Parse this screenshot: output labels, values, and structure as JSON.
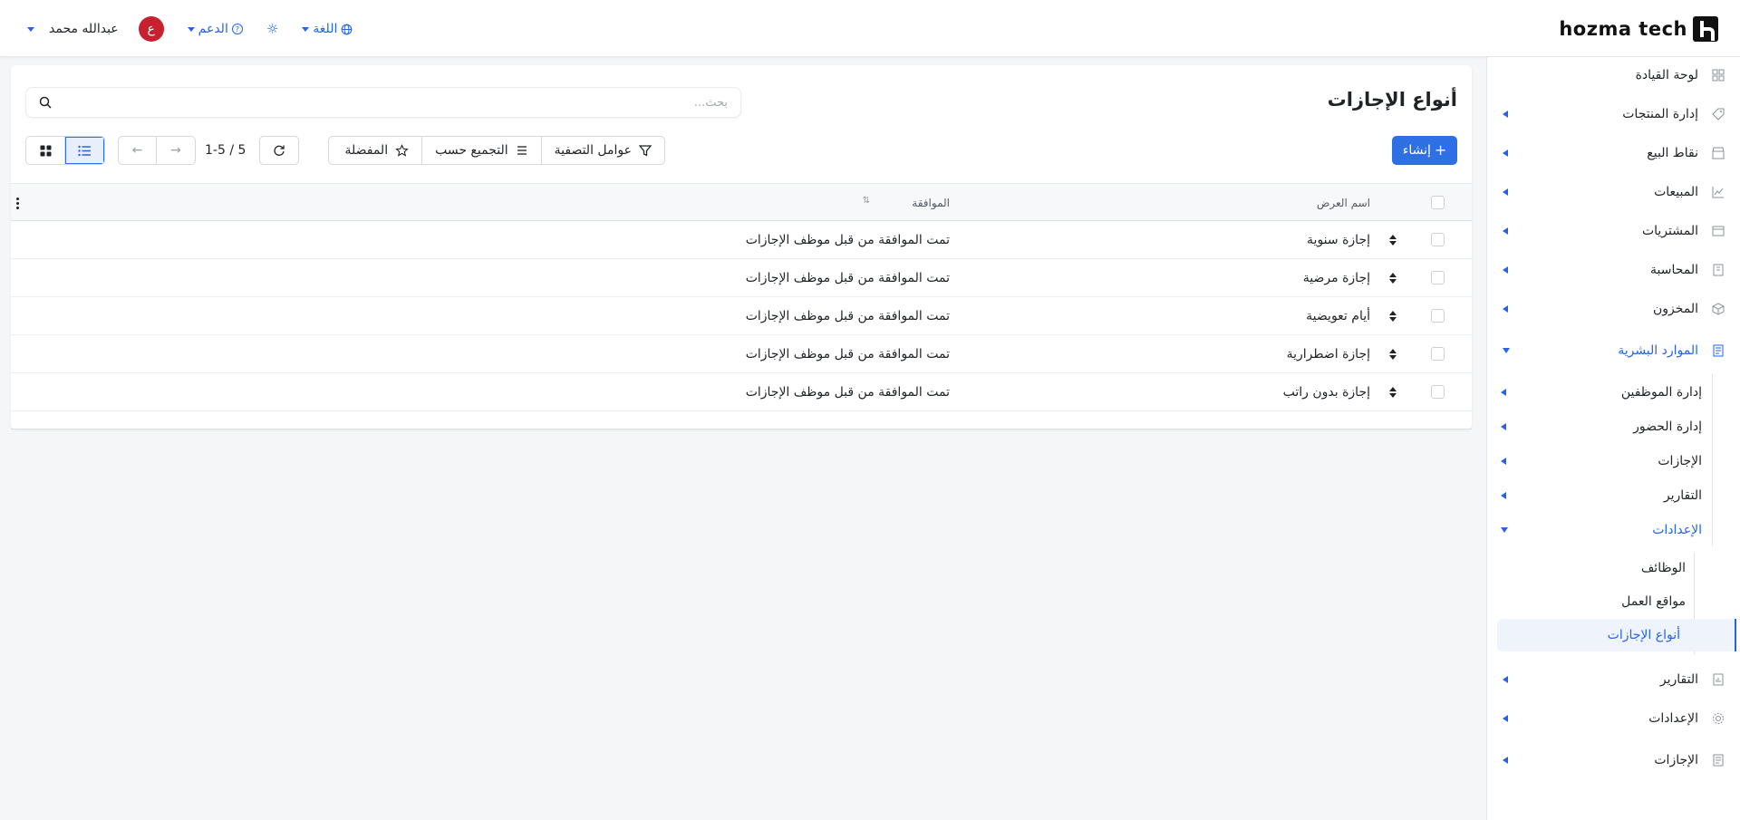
{
  "header": {
    "brand": "hozma tech",
    "user_name": "عبدالله محمد",
    "avatar_initial": "ع",
    "support_label": "الدعم",
    "language_label": "اللغة"
  },
  "sidebar": {
    "items": [
      {
        "label": "لوحة القيادة"
      },
      {
        "label": "إدارة المنتجات"
      },
      {
        "label": "نقاط البيع"
      },
      {
        "label": "المبيعات"
      },
      {
        "label": "المشتريات"
      },
      {
        "label": "المحاسبة"
      },
      {
        "label": "المخزون"
      },
      {
        "label": "الموارد البشرية"
      }
    ],
    "hr_sub": [
      {
        "label": "إدارة الموظفين"
      },
      {
        "label": "إدارة الحضور"
      },
      {
        "label": "الإجازات"
      },
      {
        "label": "التقارير"
      },
      {
        "label": "الإعدادات"
      }
    ],
    "settings_sub": [
      {
        "label": "الوظائف"
      },
      {
        "label": "مواقع العمل"
      },
      {
        "label": "أنواع الإجازات"
      }
    ],
    "bottom_items": [
      {
        "label": "التقارير"
      },
      {
        "label": "الإعدادات"
      },
      {
        "label": "الإجازات"
      }
    ],
    "accent_color": "#2563eb"
  },
  "main": {
    "title": "أنواع الإجازات",
    "search_placeholder": "بحث...",
    "create_label": "إنشاء",
    "filters_label": "عوامل التصفية",
    "group_by_label": "التجميع حسب",
    "favorites_label": "المفضلة",
    "pager": "1-5 / 5"
  },
  "table": {
    "columns": [
      "اسم العرض",
      "الموافقة"
    ],
    "rows": [
      {
        "name": "إجازة سنوية",
        "approval": "تمت الموافقة من قبل موظف الإجازات"
      },
      {
        "name": "إجازة مرضية",
        "approval": "تمت الموافقة من قبل موظف الإجازات"
      },
      {
        "name": "أيام تعويضية",
        "approval": "تمت الموافقة من قبل موظف الإجازات"
      },
      {
        "name": "إجازة اضطرارية",
        "approval": "تمت الموافقة من قبل موظف الإجازات"
      },
      {
        "name": "إجازة بدون راتب",
        "approval": "تمت الموافقة من قبل موظف الإجازات"
      }
    ]
  }
}
